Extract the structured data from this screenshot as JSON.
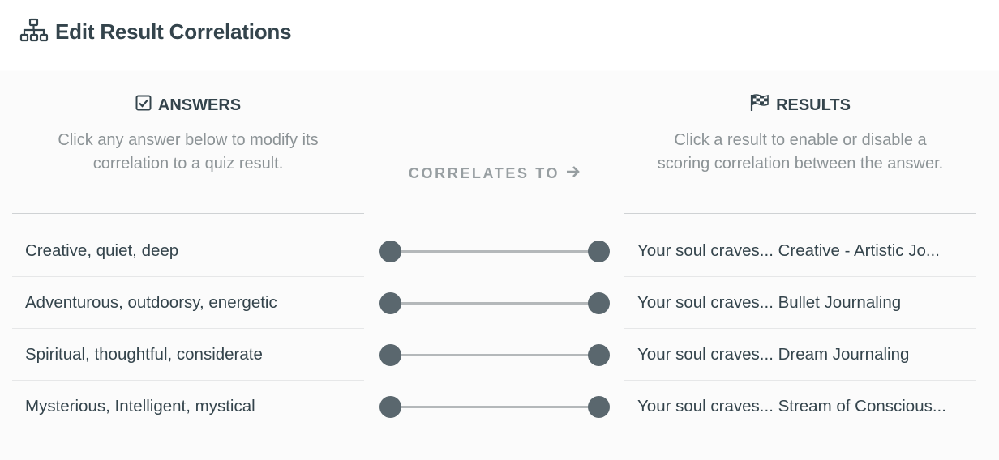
{
  "header": {
    "title": "Edit Result Correlations",
    "icon": "sitemap-icon"
  },
  "answers_column": {
    "heading": "ANSWERS",
    "icon": "checkbox-icon",
    "description": "Click any answer below to modify its correlation to a quiz result."
  },
  "results_column": {
    "heading": "RESULTS",
    "icon": "checkered-flag-icon",
    "description": "Click a result to enable or disable a scoring correlation between the answer."
  },
  "correlates_label": "CORRELATES TO",
  "answers": [
    "Creative, quiet, deep",
    "Adventurous, outdoorsy, energetic",
    "Spiritual, thoughtful, considerate",
    "Mysterious, Intelligent, mystical"
  ],
  "results": [
    "Your soul craves... Creative - Artistic Jo...",
    "Your soul craves... Bullet Journaling",
    "Your soul craves... Dream Journaling",
    "Your soul craves... Stream of Conscious..."
  ],
  "colors": {
    "text": "#34444c",
    "muted": "#8c9396",
    "node": "#5a676e",
    "link": "#b4b8ba"
  }
}
